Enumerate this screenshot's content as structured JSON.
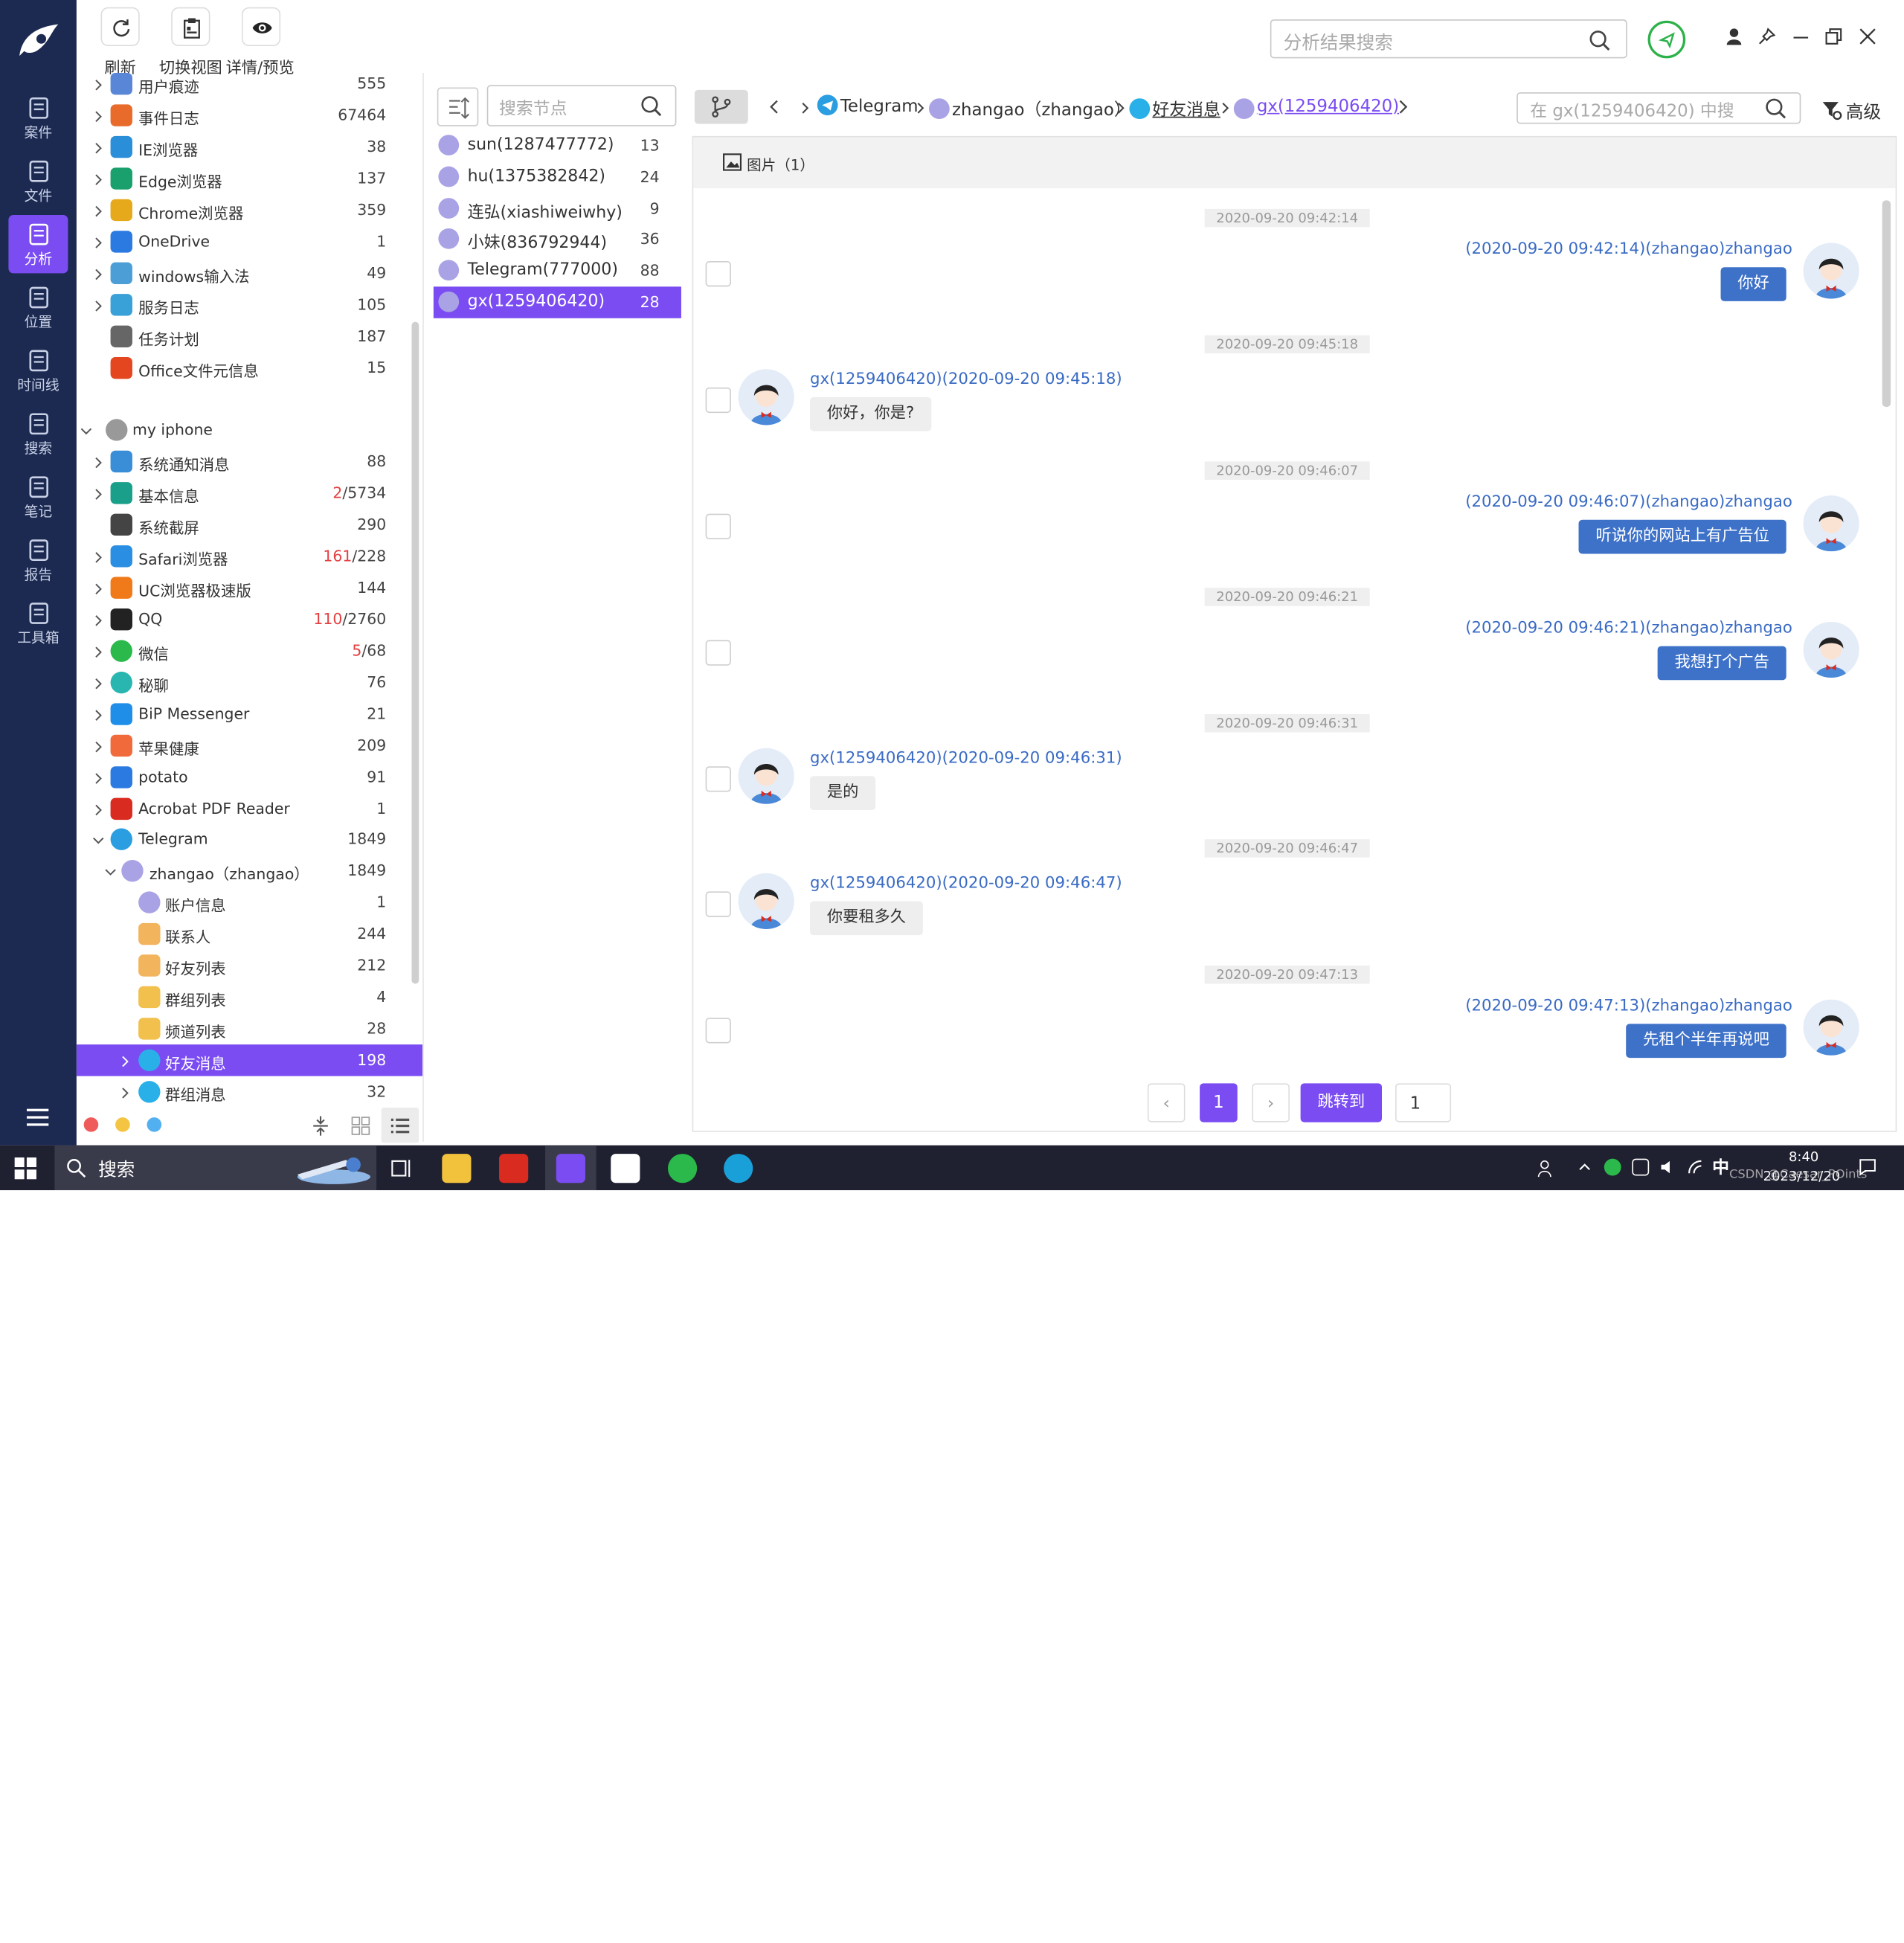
{
  "toolbar": {
    "refresh": "刷新",
    "switch_view": "切换视图",
    "details": "详情/预览",
    "search_placeholder": "分析结果搜索"
  },
  "leftnav": [
    {
      "label": "案件",
      "icon": "case-icon"
    },
    {
      "label": "文件",
      "icon": "file-icon"
    },
    {
      "label": "分析",
      "icon": "analysis-icon",
      "active": true
    },
    {
      "label": "位置",
      "icon": "location-icon"
    },
    {
      "label": "时间线",
      "icon": "timeline-icon"
    },
    {
      "label": "搜索",
      "icon": "search-icon"
    },
    {
      "label": "笔记",
      "icon": "notes-icon"
    },
    {
      "label": "报告",
      "icon": "report-icon"
    },
    {
      "label": "工具箱",
      "icon": "toolbox-icon"
    }
  ],
  "tree": [
    {
      "label": "用户痕迹",
      "count": "555",
      "icon": "user-trace-icon",
      "color": "#5a86d8"
    },
    {
      "label": "事件日志",
      "count": "67464",
      "icon": "event-log-icon",
      "color": "#e86b2c"
    },
    {
      "label": "IE浏览器",
      "count": "38",
      "icon": "ie-icon",
      "color": "#2a8fd8"
    },
    {
      "label": "Edge浏览器",
      "count": "137",
      "icon": "edge-icon",
      "color": "#1aa06d"
    },
    {
      "label": "Chrome浏览器",
      "count": "359",
      "icon": "chrome-icon",
      "color": "#e6a91b"
    },
    {
      "label": "OneDrive",
      "count": "1",
      "icon": "onedrive-icon",
      "color": "#2a7ae2"
    },
    {
      "label": "windows输入法",
      "count": "49",
      "icon": "keyboard-icon",
      "color": "#4b9ed6"
    },
    {
      "label": "服务日志",
      "count": "105",
      "icon": "service-log-icon",
      "color": "#3aa0d8"
    },
    {
      "label": "任务计划",
      "count": "187",
      "icon": "task-plan-icon",
      "color": "#666666"
    },
    {
      "label": "Office文件元信息",
      "count": "15",
      "icon": "office-icon",
      "color": "#e4471f"
    },
    {
      "label": "my iphone",
      "count": "",
      "icon": "apple-icon",
      "color": "#999999"
    },
    {
      "label": "系统通知消息",
      "count": "88",
      "icon": "notification-icon",
      "color": "#3a8ed8"
    },
    {
      "label": "基本信息",
      "count_red": "2",
      "count": "/5734",
      "icon": "basic-info-icon",
      "color": "#1aa08a"
    },
    {
      "label": "系统截屏",
      "count": "290",
      "icon": "screenshot-icon",
      "color": "#444444"
    },
    {
      "label": "Safari浏览器",
      "count_red": "161",
      "count": "/228",
      "icon": "safari-icon",
      "color": "#2a8fe2"
    },
    {
      "label": "UC浏览器极速版",
      "count": "144",
      "icon": "uc-icon",
      "color": "#f07a1a"
    },
    {
      "label": "QQ",
      "count_red": "110",
      "count": "/2760",
      "icon": "qq-icon",
      "color": "#222222"
    },
    {
      "label": "微信",
      "count_red": "5",
      "count": "/68",
      "icon": "wechat-icon",
      "color": "#2ab94a"
    },
    {
      "label": "秘聊",
      "count": "76",
      "icon": "secret-chat-icon",
      "color": "#29b6b0"
    },
    {
      "label": "BiP Messenger",
      "count": "21",
      "icon": "bip-icon",
      "color": "#1f8ee8"
    },
    {
      "label": "苹果健康",
      "count": "209",
      "icon": "health-icon",
      "color": "#f06a3c"
    },
    {
      "label": "potato",
      "count": "91",
      "icon": "potato-icon",
      "color": "#2a7ae2"
    },
    {
      "label": "Acrobat PDF Reader",
      "count": "1",
      "icon": "pdf-icon",
      "color": "#d92b1f"
    },
    {
      "label": "Telegram",
      "count": "1849",
      "icon": "telegram-icon",
      "color": "#2a9ee0"
    },
    {
      "label": "zhangao（zhangao）",
      "count": "1849",
      "icon": "user-avatar-icon",
      "color": "#a9a3e6"
    },
    {
      "label": "账户信息",
      "count": "1",
      "icon": "account-icon",
      "color": "#a9a3e6"
    },
    {
      "label": "联系人",
      "count": "244",
      "icon": "contacts-icon",
      "color": "#f2b45c"
    },
    {
      "label": "好友列表",
      "count": "212",
      "icon": "friends-list-icon",
      "color": "#f2b45c"
    },
    {
      "label": "群组列表",
      "count": "4",
      "icon": "group-list-icon",
      "color": "#f2c04c"
    },
    {
      "label": "频道列表",
      "count": "28",
      "icon": "channel-list-icon",
      "color": "#f2c04c"
    },
    {
      "label": "好友消息",
      "count": "198",
      "icon": "chat-bubble-icon",
      "color": "#2ab0e8"
    },
    {
      "label": "群组消息",
      "count": "32",
      "icon": "chat-bubble-icon",
      "color": "#2ab0e8"
    }
  ],
  "nodes": {
    "search_placeholder": "搜索节点",
    "items": [
      {
        "label": "sun(1287477772)",
        "count": "13"
      },
      {
        "label": "hu(1375382842)",
        "count": "24"
      },
      {
        "label": "连弘(xiashiweiwhy)",
        "count": "9"
      },
      {
        "label": "小妹(836792944)",
        "count": "36"
      },
      {
        "label": "Telegram(777000)",
        "count": "88"
      },
      {
        "label": "gx(1259406420)",
        "count": "28"
      }
    ]
  },
  "breadcrumb": {
    "items": [
      "Telegram",
      "zhangao（zhangao）",
      "好友消息",
      "gx(1259406420)"
    ],
    "search_placeholder": "在 gx(1259406420) 中搜",
    "advanced": "高级"
  },
  "filter": {
    "label": "图片（1）"
  },
  "messages": [
    {
      "time": "2020-09-20 09:42:14",
      "side": "right",
      "meta": "(2020-09-20 09:42:14)(zhangao)zhangao",
      "text": "你好"
    },
    {
      "time": "2020-09-20 09:45:18",
      "side": "left",
      "meta": "gx(1259406420)(2020-09-20 09:45:18)",
      "text": "你好，你是?"
    },
    {
      "time": "2020-09-20 09:46:07",
      "side": "right",
      "meta": "(2020-09-20 09:46:07)(zhangao)zhangao",
      "text": "听说你的网站上有广告位"
    },
    {
      "time": "2020-09-20 09:46:21",
      "side": "right",
      "meta": "(2020-09-20 09:46:21)(zhangao)zhangao",
      "text": "我想打个广告"
    },
    {
      "time": "2020-09-20 09:46:31",
      "side": "left",
      "meta": "gx(1259406420)(2020-09-20 09:46:31)",
      "text": "是的"
    },
    {
      "time": "2020-09-20 09:46:47",
      "side": "left",
      "meta": "gx(1259406420)(2020-09-20 09:46:47)",
      "text": "你要租多久"
    },
    {
      "time": "2020-09-20 09:47:13",
      "side": "right",
      "meta": "(2020-09-20 09:47:13)(zhangao)zhangao",
      "text": "先租个半年再说吧"
    }
  ],
  "pagination": {
    "current": "1",
    "goto": "跳转到",
    "page_input": "1"
  },
  "taskbar": {
    "search": "搜索",
    "ime": "中",
    "time": "8:40",
    "date": "2023/12/20",
    "watermark": "CSDN @Caesar_POints"
  }
}
